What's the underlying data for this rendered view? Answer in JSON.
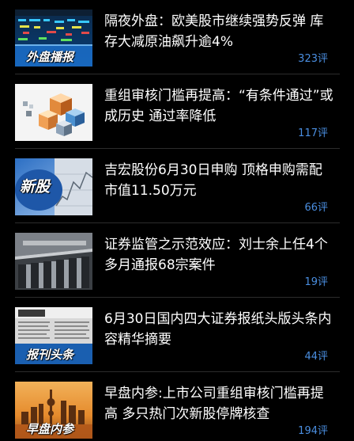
{
  "news": {
    "items": [
      {
        "title": "隔夜外盘：欧美股市继续强势反弹 库存大减原油飙升逾4%",
        "comments": "323评",
        "thumb_icon": "stock-board-thumbnail",
        "thumb_caption": "外盘播报"
      },
      {
        "title": "重组审核门槛再提高：“有条件通过”或成历史 通过率降低",
        "comments": "117评",
        "thumb_icon": "cubes-thumbnail",
        "thumb_caption": ""
      },
      {
        "title": "吉宏股份6月30日申购 顶格申购需配市值11.50万元",
        "comments": "66评",
        "thumb_icon": "new-share-thumbnail",
        "thumb_caption": ""
      },
      {
        "title": "证券监管之示范效应：刘士余上任4个多月通报68宗案件",
        "comments": "19评",
        "thumb_icon": "csrc-building-thumbnail",
        "thumb_caption": ""
      },
      {
        "title": "6月30日国内四大证券报纸头版头条内容精华摘要",
        "comments": "44评",
        "thumb_icon": "newspaper-thumbnail",
        "thumb_caption": "报刊头条"
      },
      {
        "title": "早盘内参:上市公司重组审核门槛再提高 多只热门次新股停牌核查",
        "comments": "194评",
        "thumb_icon": "city-skyline-thumbnail",
        "thumb_caption": "早盘内参"
      }
    ]
  },
  "colors": {
    "background": "#000000",
    "title": "#ffffff",
    "comment": "#4a8ee0",
    "divider": "#2c2c2c"
  }
}
